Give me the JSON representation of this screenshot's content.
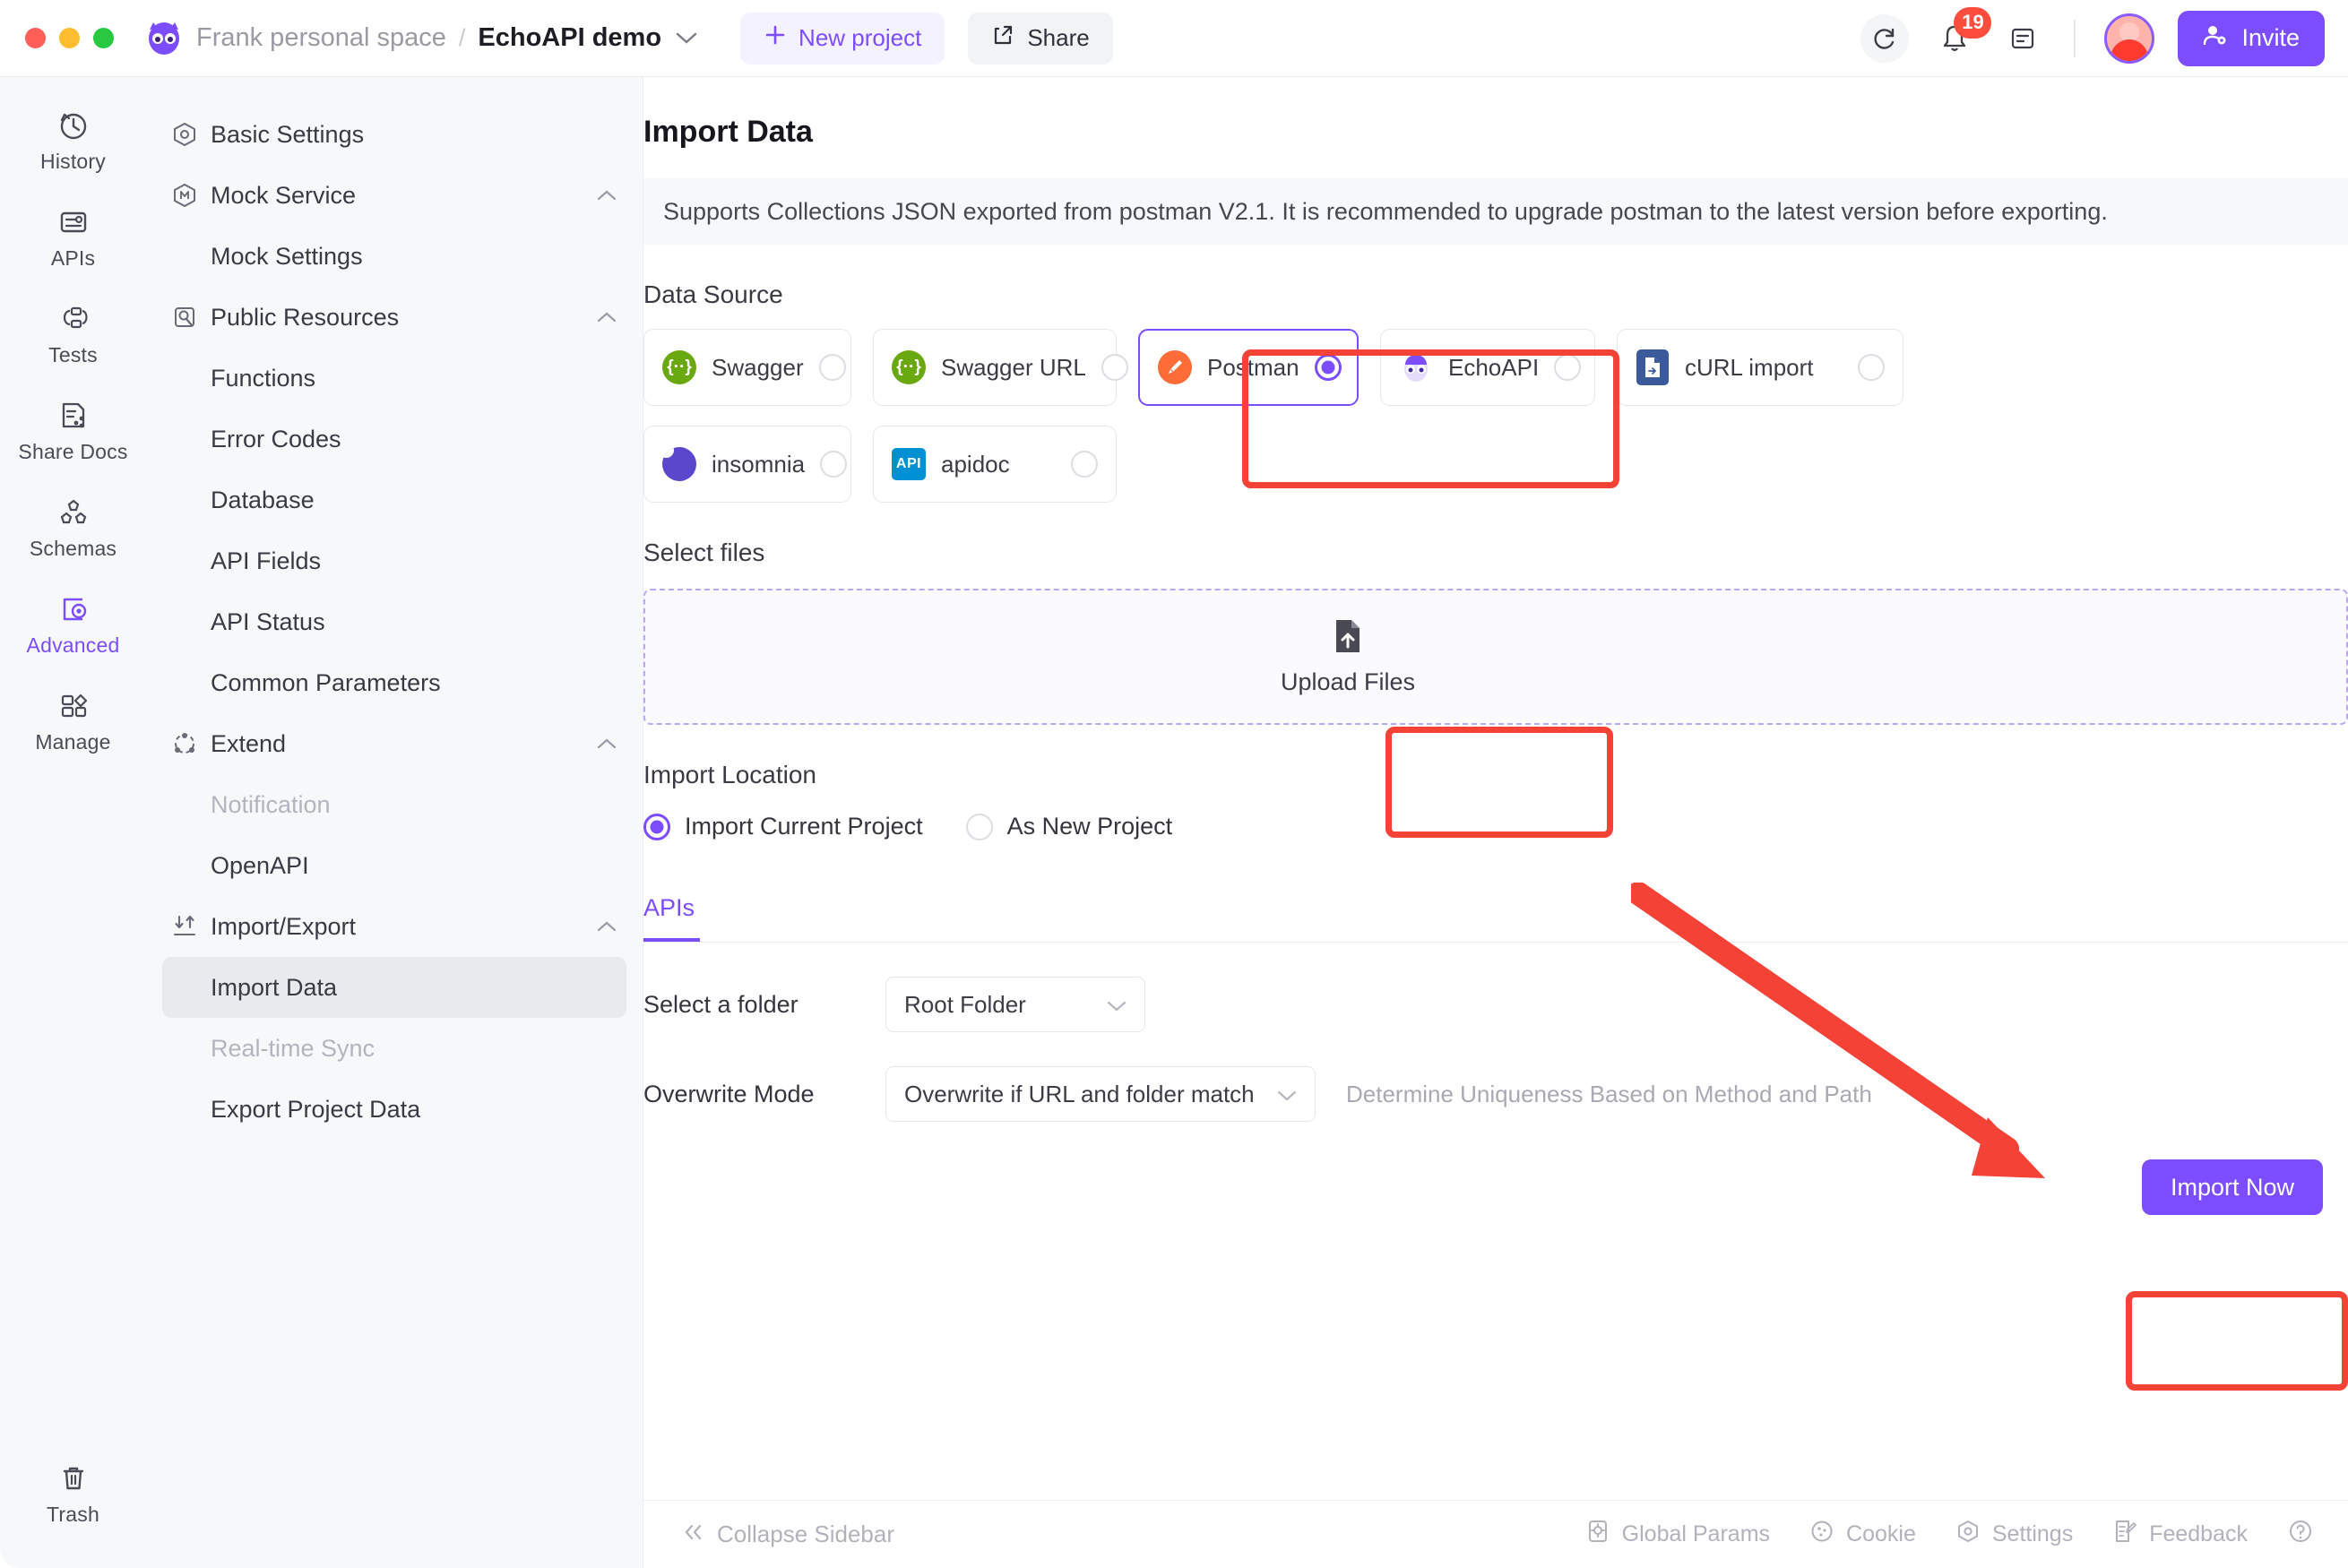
{
  "window": {
    "traffic_lights": [
      "close",
      "minimize",
      "maximize"
    ]
  },
  "header": {
    "workspace": "Frank personal space",
    "separator": "/",
    "project": "EchoAPI demo",
    "new_project_label": "New project",
    "share_label": "Share",
    "notification_count": "19",
    "invite_label": "Invite",
    "icons": {
      "refresh": "refresh-icon",
      "bell": "bell-icon",
      "notes": "notes-icon",
      "avatar": "avatar",
      "invite": "add-user-icon",
      "plus": "plus-icon",
      "share": "share-icon",
      "caret": "chevron-down-icon"
    }
  },
  "rail": {
    "items": [
      {
        "label": "History",
        "icon": "history-icon",
        "active": false
      },
      {
        "label": "APIs",
        "icon": "apis-icon",
        "active": false
      },
      {
        "label": "Tests",
        "icon": "tests-icon",
        "active": false
      },
      {
        "label": "Share Docs",
        "icon": "share-docs-icon",
        "active": false
      },
      {
        "label": "Schemas",
        "icon": "schemas-icon",
        "active": false
      },
      {
        "label": "Advanced",
        "icon": "advanced-icon",
        "active": true
      },
      {
        "label": "Manage",
        "icon": "manage-icon",
        "active": false
      }
    ],
    "trash": {
      "label": "Trash",
      "icon": "trash-icon"
    }
  },
  "sidebar": {
    "items": [
      {
        "label": "Basic Settings",
        "type": "group",
        "icon": "hexagon-gear-icon",
        "collapsible": false
      },
      {
        "label": "Mock Service",
        "type": "group",
        "icon": "mock-icon",
        "collapsible": true
      },
      {
        "label": "Mock Settings",
        "type": "child"
      },
      {
        "label": "Public Resources",
        "type": "group",
        "icon": "resources-icon",
        "collapsible": true
      },
      {
        "label": "Functions",
        "type": "child"
      },
      {
        "label": "Error Codes",
        "type": "child"
      },
      {
        "label": "Database",
        "type": "child"
      },
      {
        "label": "API Fields",
        "type": "child"
      },
      {
        "label": "API Status",
        "type": "child"
      },
      {
        "label": "Common Parameters",
        "type": "child"
      },
      {
        "label": "Extend",
        "type": "group",
        "icon": "extend-icon",
        "collapsible": true
      },
      {
        "label": "Notification",
        "type": "child",
        "dim": true
      },
      {
        "label": "OpenAPI",
        "type": "child"
      },
      {
        "label": "Import/Export",
        "type": "group",
        "icon": "import-export-icon",
        "collapsible": true
      },
      {
        "label": "Import Data",
        "type": "child",
        "selected": true
      },
      {
        "label": "Real-time Sync",
        "type": "child",
        "dim": true
      },
      {
        "label": "Export Project Data",
        "type": "child"
      }
    ]
  },
  "main": {
    "title": "Import Data",
    "banner": "Supports Collections JSON exported from postman V2.1. It is recommended to upgrade postman to the latest version before exporting.",
    "data_source_label": "Data Source",
    "data_sources": [
      {
        "name": "Swagger",
        "icon": "swagger-icon",
        "selected": false
      },
      {
        "name": "Swagger URL",
        "icon": "swagger-icon",
        "selected": false
      },
      {
        "name": "Postman",
        "icon": "postman-icon",
        "selected": true
      },
      {
        "name": "EchoAPI",
        "icon": "echoapi-icon",
        "selected": false
      },
      {
        "name": "cURL import",
        "icon": "curl-file-icon",
        "selected": false
      },
      {
        "name": "insomnia",
        "icon": "insomnia-icon",
        "selected": false
      },
      {
        "name": "apidoc",
        "icon": "apidoc-icon",
        "selected": false
      }
    ],
    "select_files_label": "Select files",
    "upload_label": "Upload Files",
    "upload_icon": "file-upload-icon",
    "import_location_label": "Import Location",
    "location_options": [
      {
        "label": "Import Current Project",
        "selected": true
      },
      {
        "label": "As New Project",
        "selected": false
      }
    ],
    "tabs": [
      {
        "label": "APIs",
        "active": true
      }
    ],
    "folder_label": "Select a folder",
    "folder_value": "Root Folder",
    "overwrite_label": "Overwrite Mode",
    "overwrite_value": "Overwrite if URL and folder match",
    "uniqueness_hint": "Determine Uniqueness Based on Method and Path",
    "import_button": "Import Now"
  },
  "statusbar": {
    "collapse_label": "Collapse Sidebar",
    "collapse_icon": "double-chevron-left-icon",
    "items": [
      {
        "label": "Global Params",
        "icon": "global-params-icon"
      },
      {
        "label": "Cookie",
        "icon": "cookie-icon"
      },
      {
        "label": "Settings",
        "icon": "settings-icon"
      },
      {
        "label": "Feedback",
        "icon": "feedback-icon"
      }
    ],
    "help_icon": "help-icon"
  },
  "annotations": {
    "highlight_color": "#f44336",
    "boxes": [
      "postman-source-card",
      "upload-files-button",
      "import-now-button"
    ],
    "arrow": "red-arrow-pointing-to-import-now"
  },
  "colors": {
    "accent": "#7c4dff",
    "annotation": "#f44336",
    "badge": "#ff4d3d"
  }
}
